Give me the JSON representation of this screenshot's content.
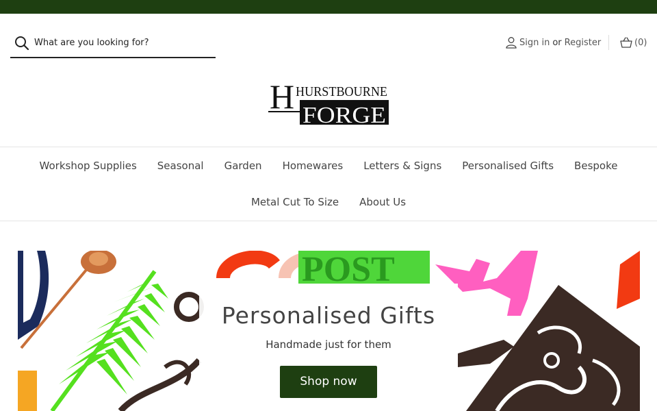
{
  "header": {
    "search": {
      "placeholder": "What are you looking for?"
    },
    "account": {
      "sign_in": "Sign in",
      "or": "or",
      "register": "Register"
    },
    "cart": {
      "count_text": "(0)"
    },
    "logo": {
      "line1": "HURSTBOURNE",
      "line2": "FORGE"
    }
  },
  "nav": {
    "row1": [
      "Workshop Supplies",
      "Seasonal",
      "Garden",
      "Homewares",
      "Letters & Signs",
      "Personalised Gifts",
      "Bespoke"
    ],
    "row2": [
      "Metal Cut To Size",
      "About Us"
    ]
  },
  "hero": {
    "title": "Personalised Gifts",
    "subtitle": "Handmade just for them",
    "button": "Shop now"
  },
  "colors": {
    "brand_green": "#1e3f11",
    "fern_green": "#55e01f",
    "pink": "#ff5fc0",
    "orange_red": "#f23a12",
    "dark_brown": "#3b2a24",
    "copper": "#c8703a",
    "navy": "#1b2b5c"
  },
  "icons": [
    "search-icon",
    "user-icon",
    "basket-icon"
  ]
}
